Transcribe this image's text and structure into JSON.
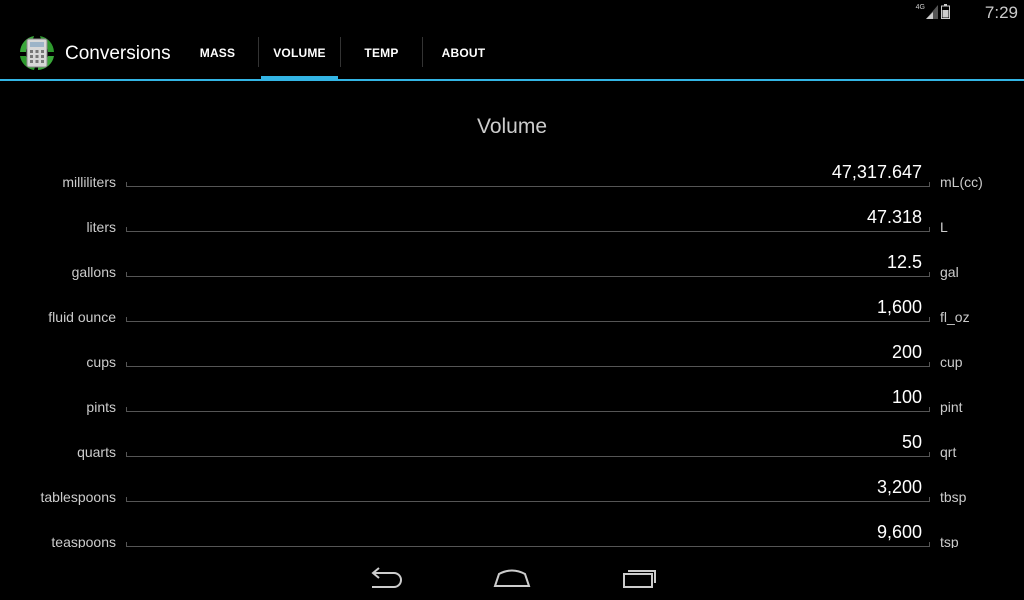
{
  "status": {
    "time": "7:29",
    "network": "4G",
    "icons": [
      "signal-icon",
      "battery-icon"
    ]
  },
  "app": {
    "title": "Conversions",
    "icon": "calculator-recycle-icon",
    "accent_color": "#33b5e5"
  },
  "tabs": [
    {
      "label": "MASS",
      "selected": false
    },
    {
      "label": "VOLUME",
      "selected": true
    },
    {
      "label": "TEMP",
      "selected": false
    },
    {
      "label": "ABOUT",
      "selected": false
    }
  ],
  "page": {
    "title": "Volume"
  },
  "rows": [
    {
      "label": "milliliters",
      "value": "47,317.647",
      "unit": "mL(cc)"
    },
    {
      "label": "liters",
      "value": "47.318",
      "unit": "L"
    },
    {
      "label": "gallons",
      "value": "12.5",
      "unit": "gal"
    },
    {
      "label": "fluid ounce",
      "value": "1,600",
      "unit": "fl_oz"
    },
    {
      "label": "cups",
      "value": "200",
      "unit": "cup"
    },
    {
      "label": "pints",
      "value": "100",
      "unit": "pint"
    },
    {
      "label": "quarts",
      "value": "50",
      "unit": "qrt"
    },
    {
      "label": "tablespoons",
      "value": "3,200",
      "unit": "tbsp"
    },
    {
      "label": "teaspoons",
      "value": "9,600",
      "unit": "tsp"
    }
  ],
  "navbar": {
    "buttons": [
      "back-icon",
      "home-icon",
      "recent-apps-icon"
    ]
  }
}
